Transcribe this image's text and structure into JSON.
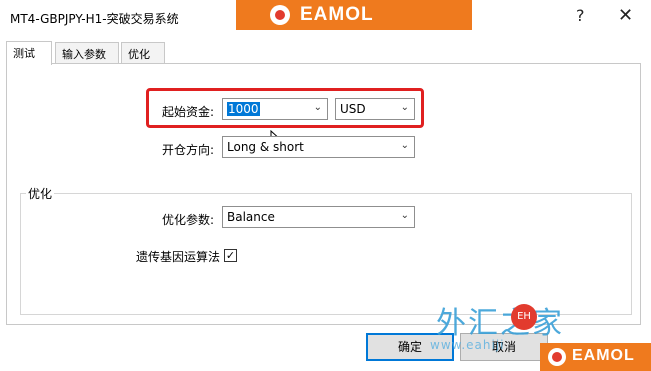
{
  "window": {
    "title": "MT4-GBPJPY-H1-突破交易系统",
    "help_label": "?",
    "close_label": "✕"
  },
  "brand": {
    "text": "EAMOL"
  },
  "tabs": [
    {
      "label": "测试",
      "active": true
    },
    {
      "label": "输入参数",
      "active": false
    },
    {
      "label": "优化",
      "active": false
    }
  ],
  "testing": {
    "initial_deposit_label": "起始资金:",
    "initial_deposit_value": "1000",
    "currency_value": "USD",
    "direction_label": "开仓方向:",
    "direction_value": "Long & short"
  },
  "optimization": {
    "group_title": "优化",
    "param_label": "优化参数:",
    "param_value": "Balance",
    "genetic_label": "遗传基因运算法",
    "genetic_checked": true
  },
  "buttons": {
    "ok_label": "确定",
    "cancel_label": "取消"
  },
  "watermark": {
    "text": "外汇之家",
    "circle_text": "EH",
    "url": "www.eahiji"
  },
  "colors": {
    "highlight": "#e02020",
    "banner": "#ef7a1e",
    "selection": "#0078d7",
    "default_button_border": "#0078d7"
  }
}
